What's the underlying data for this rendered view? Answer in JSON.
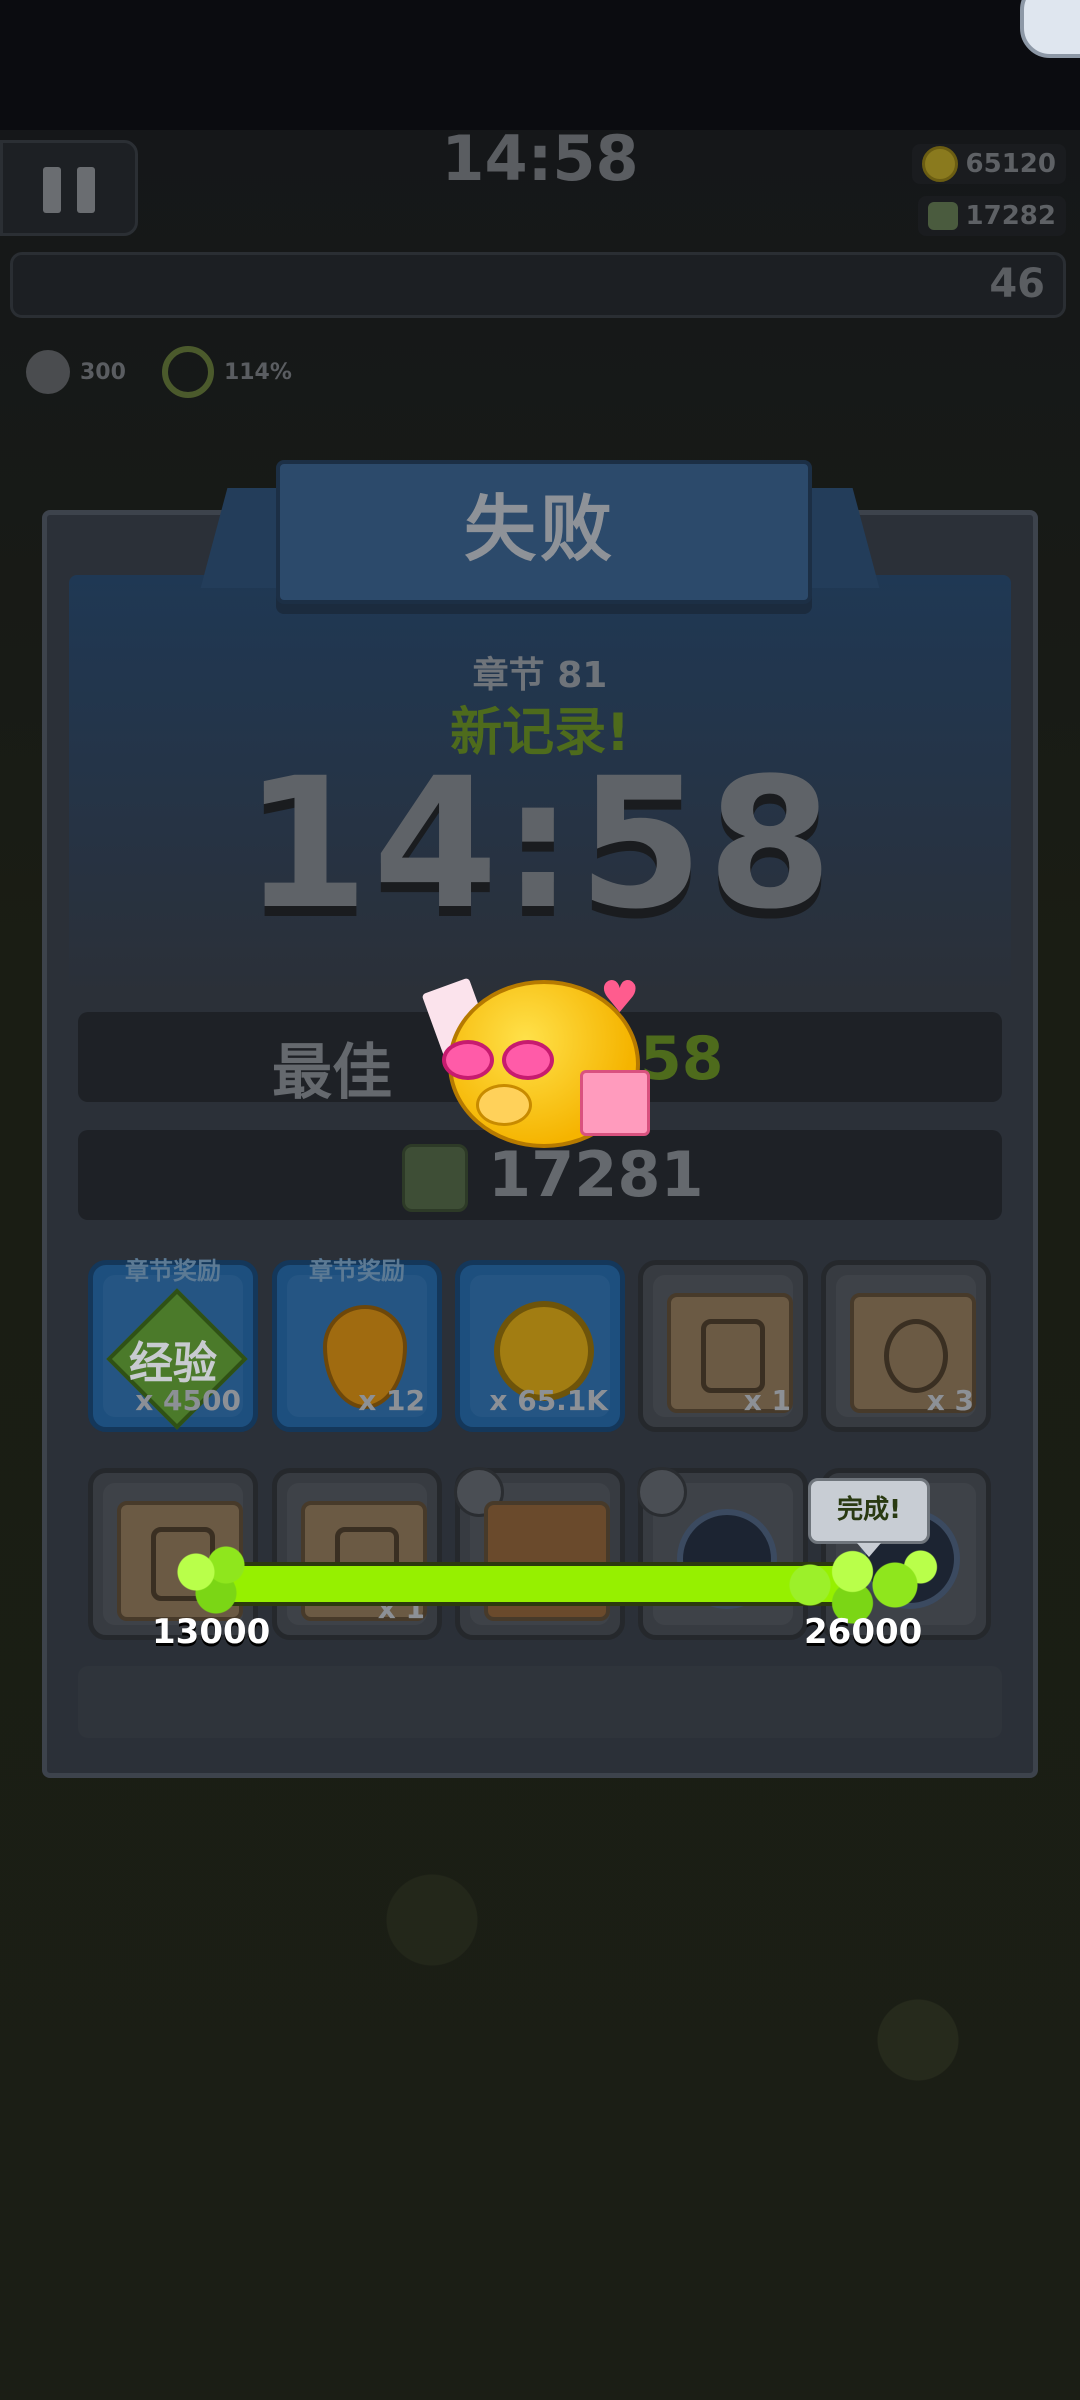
{
  "hud": {
    "timer": "14:58",
    "coins": "65120",
    "kills": "17282",
    "level": "46",
    "minion_count": "300",
    "percent": "114%"
  },
  "result": {
    "title": "失败",
    "chapter": "章节 81",
    "new_record": "新记录!",
    "time": "14:58",
    "best_label": "最佳",
    "best_value": "58",
    "kills": "17281"
  },
  "rewards": {
    "row1": [
      {
        "tag": "章节奖励",
        "icon": "xp-icon",
        "label": "经验",
        "qty": "x 4500",
        "style": "blue"
      },
      {
        "tag": "章节奖励",
        "icon": "oil-drop-icon",
        "qty": "x 12",
        "style": "blue"
      },
      {
        "icon": "gold-coin-icon",
        "qty": "x 65.1K",
        "style": "blue"
      },
      {
        "icon": "glove-scroll-icon",
        "qty": "x 1",
        "style": "gray"
      },
      {
        "icon": "belt-scroll-icon",
        "qty": "x 3",
        "style": "gray"
      }
    ],
    "row2": [
      {
        "icon": "armor-scroll-icon",
        "style": "gray"
      },
      {
        "icon": "scroll-icon",
        "qty": "x 1",
        "style": "gray"
      },
      {
        "icon": "jacket-icon",
        "style": "gray"
      },
      {
        "icon": "belt-icon",
        "style": "gray"
      },
      {
        "icon": "belt-icon",
        "style": "gray"
      }
    ]
  },
  "progress": {
    "left_value": "13000",
    "right_value": "26000",
    "done_label": "完成!",
    "fill_fraction": 1.0,
    "bar_color": "#96f000"
  }
}
